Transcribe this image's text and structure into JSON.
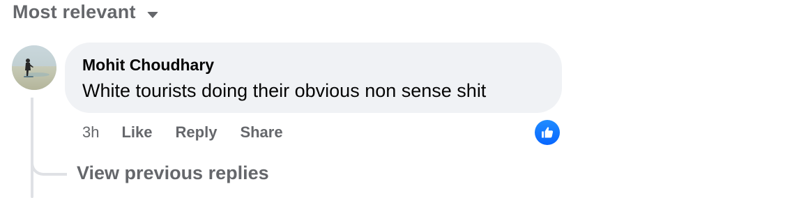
{
  "sort": {
    "label": "Most relevant",
    "icon": "caret-down-icon"
  },
  "comment": {
    "author": "Mohit Choudhary",
    "text": "White tourists doing their obvious non sense shit",
    "time": "3h",
    "actions": {
      "like": "Like",
      "reply": "Reply",
      "share": "Share"
    },
    "reaction_icon": "thumbs-up-icon",
    "avatar_icon": "user-avatar"
  },
  "replies": {
    "view_previous_label": "View previous replies"
  },
  "colors": {
    "secondary_text": "#65676b",
    "bubble_bg": "#f0f2f5",
    "like_blue": "#0866ff",
    "thread_line": "#dfe1e5"
  }
}
